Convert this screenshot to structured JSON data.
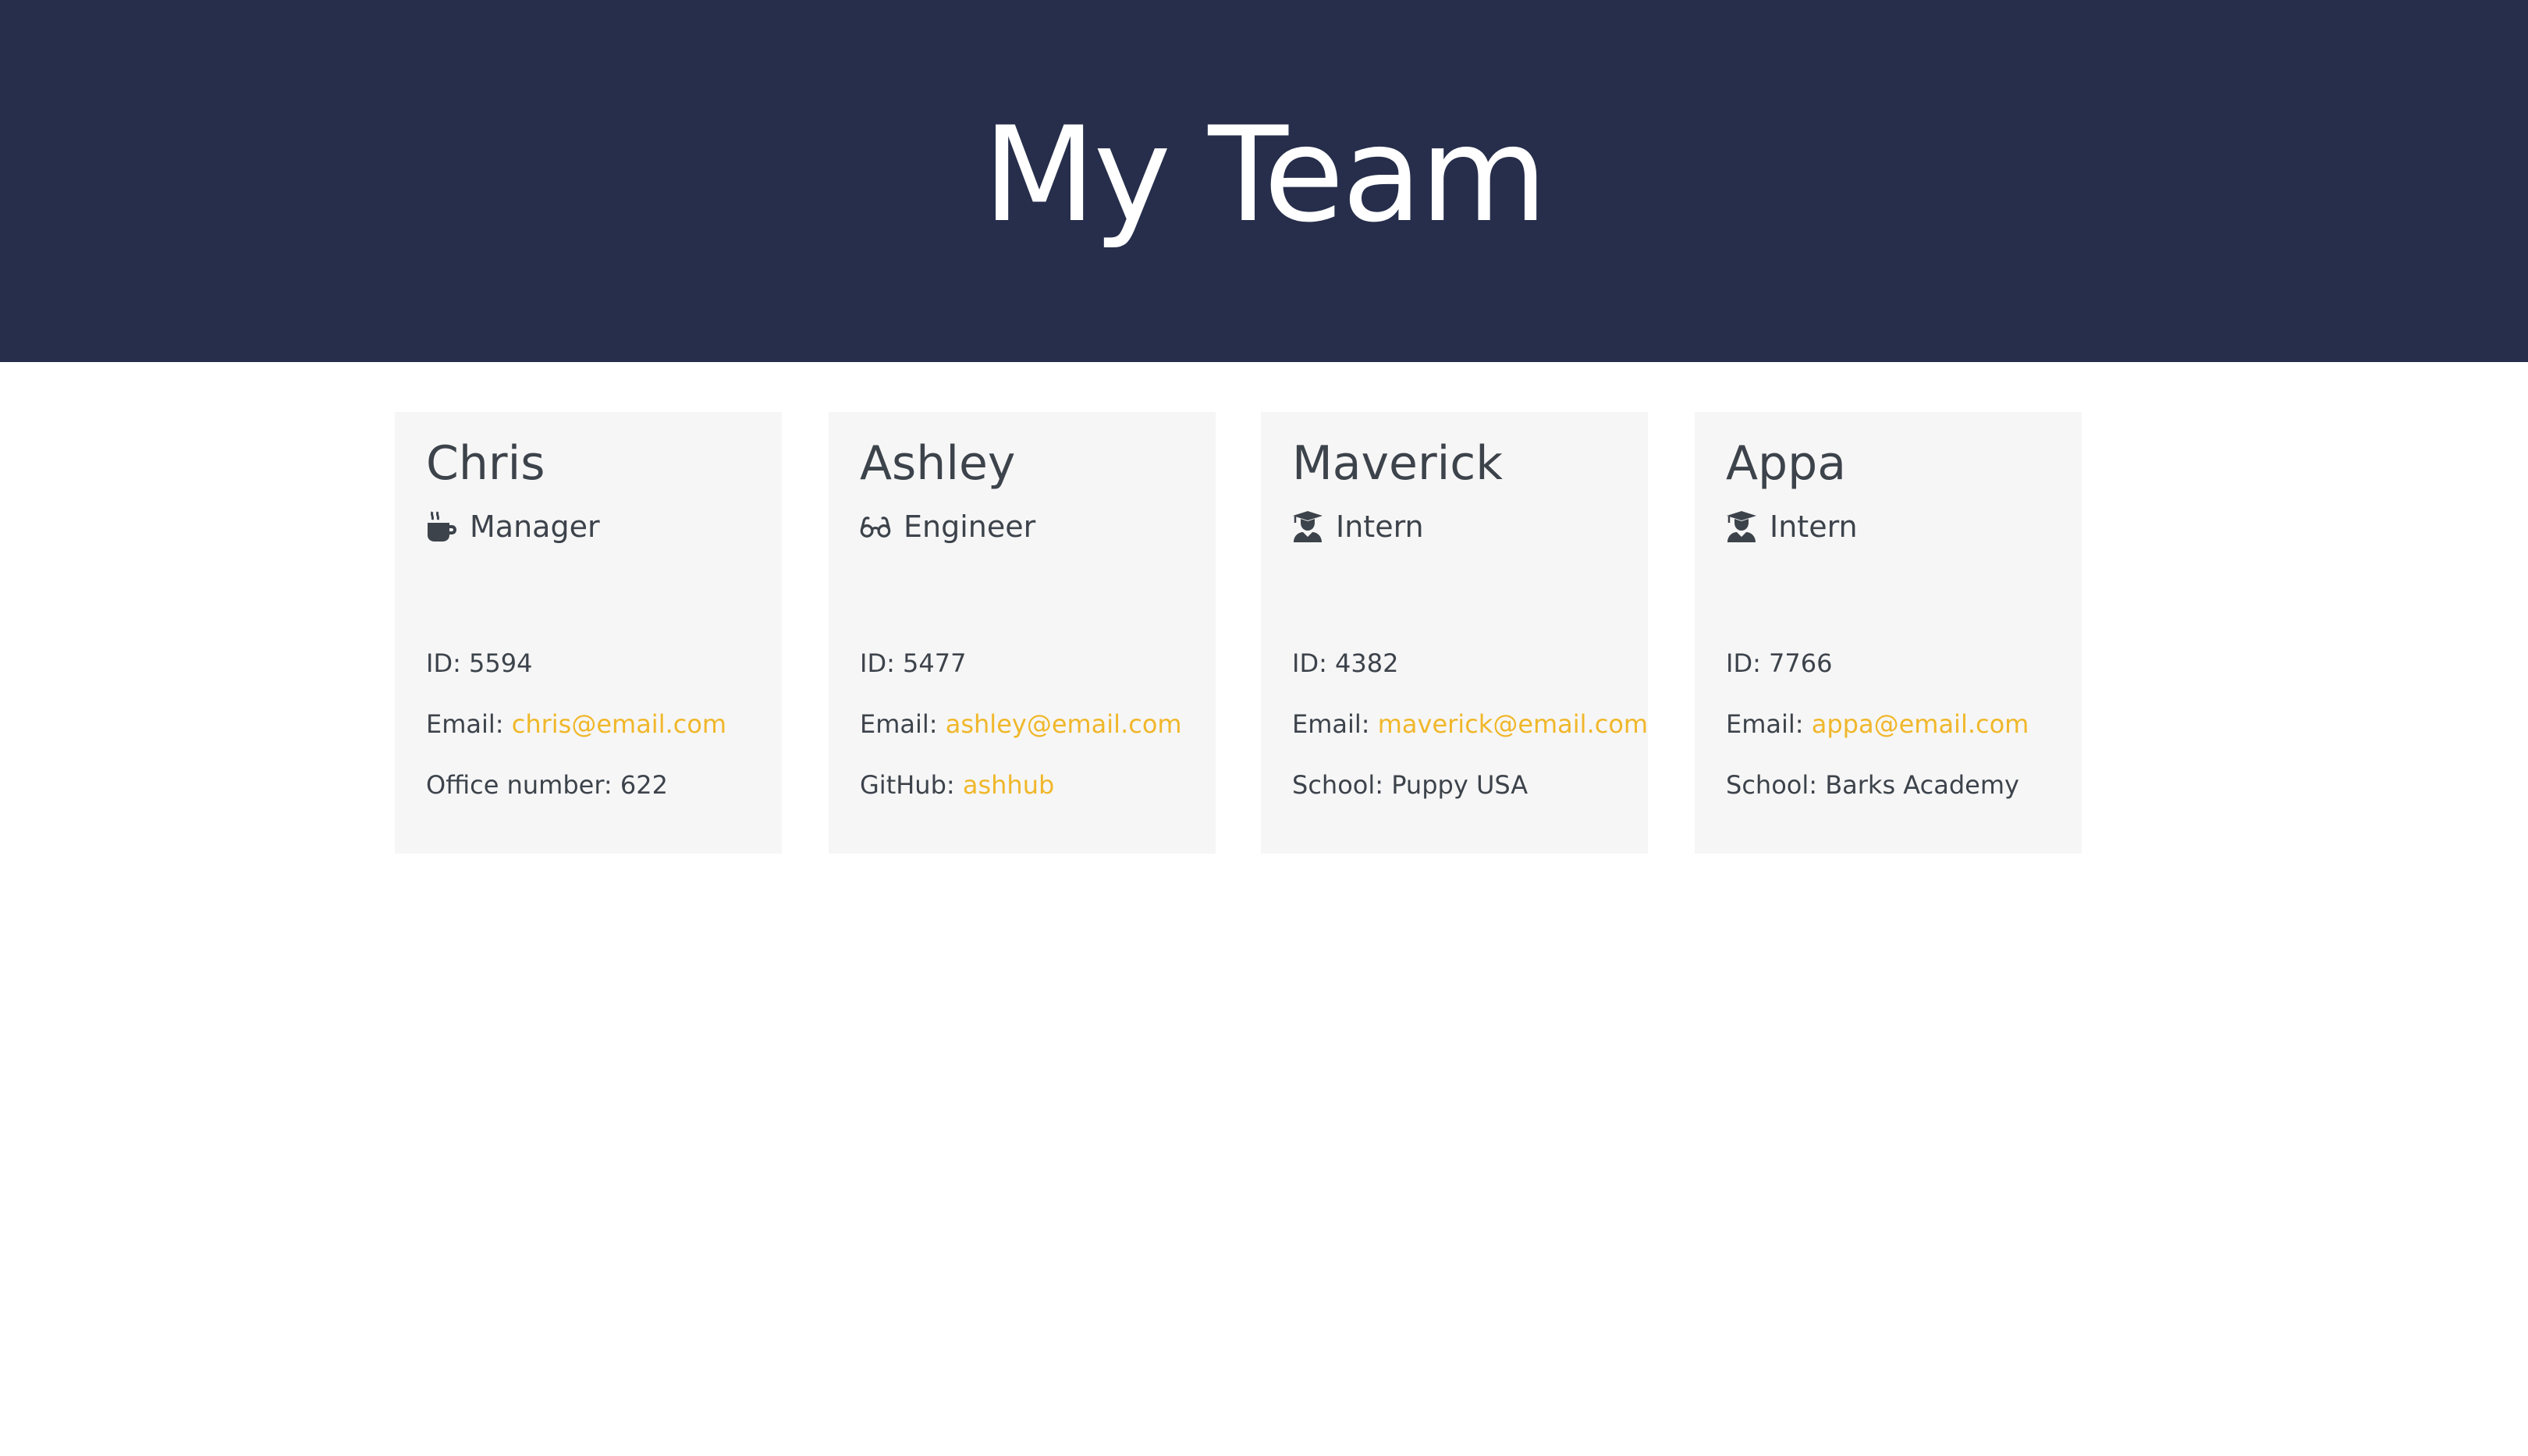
{
  "header": {
    "title": "My Team"
  },
  "colors": {
    "header_bg": "#262e4b",
    "card_bg": "#f6f6f6",
    "text": "#3d434b",
    "link": "#f0b72a"
  },
  "employees": [
    {
      "name": "Chris",
      "role": "Manager",
      "icon": "coffee-mug-icon",
      "id_label": "ID:",
      "id": "5594",
      "email_label": "Email:",
      "email": "chris@email.com",
      "extra_label": "Office number:",
      "extra_value": "622"
    },
    {
      "name": "Ashley",
      "role": "Engineer",
      "icon": "glasses-icon",
      "id_label": "ID:",
      "id": "5477",
      "email_label": "Email:",
      "email": "ashley@email.com",
      "extra_label": "GitHub:",
      "extra_value": "ashhub"
    },
    {
      "name": "Maverick",
      "role": "Intern",
      "icon": "graduate-icon",
      "id_label": "ID:",
      "id": "4382",
      "email_label": "Email:",
      "email": "maverick@email.com",
      "extra_label": "School:",
      "extra_value": "Puppy USA"
    },
    {
      "name": "Appa",
      "role": "Intern",
      "icon": "graduate-icon",
      "id_label": "ID:",
      "id": "7766",
      "email_label": "Email:",
      "email": "appa@email.com",
      "extra_label": "School:",
      "extra_value": "Barks Academy"
    }
  ]
}
